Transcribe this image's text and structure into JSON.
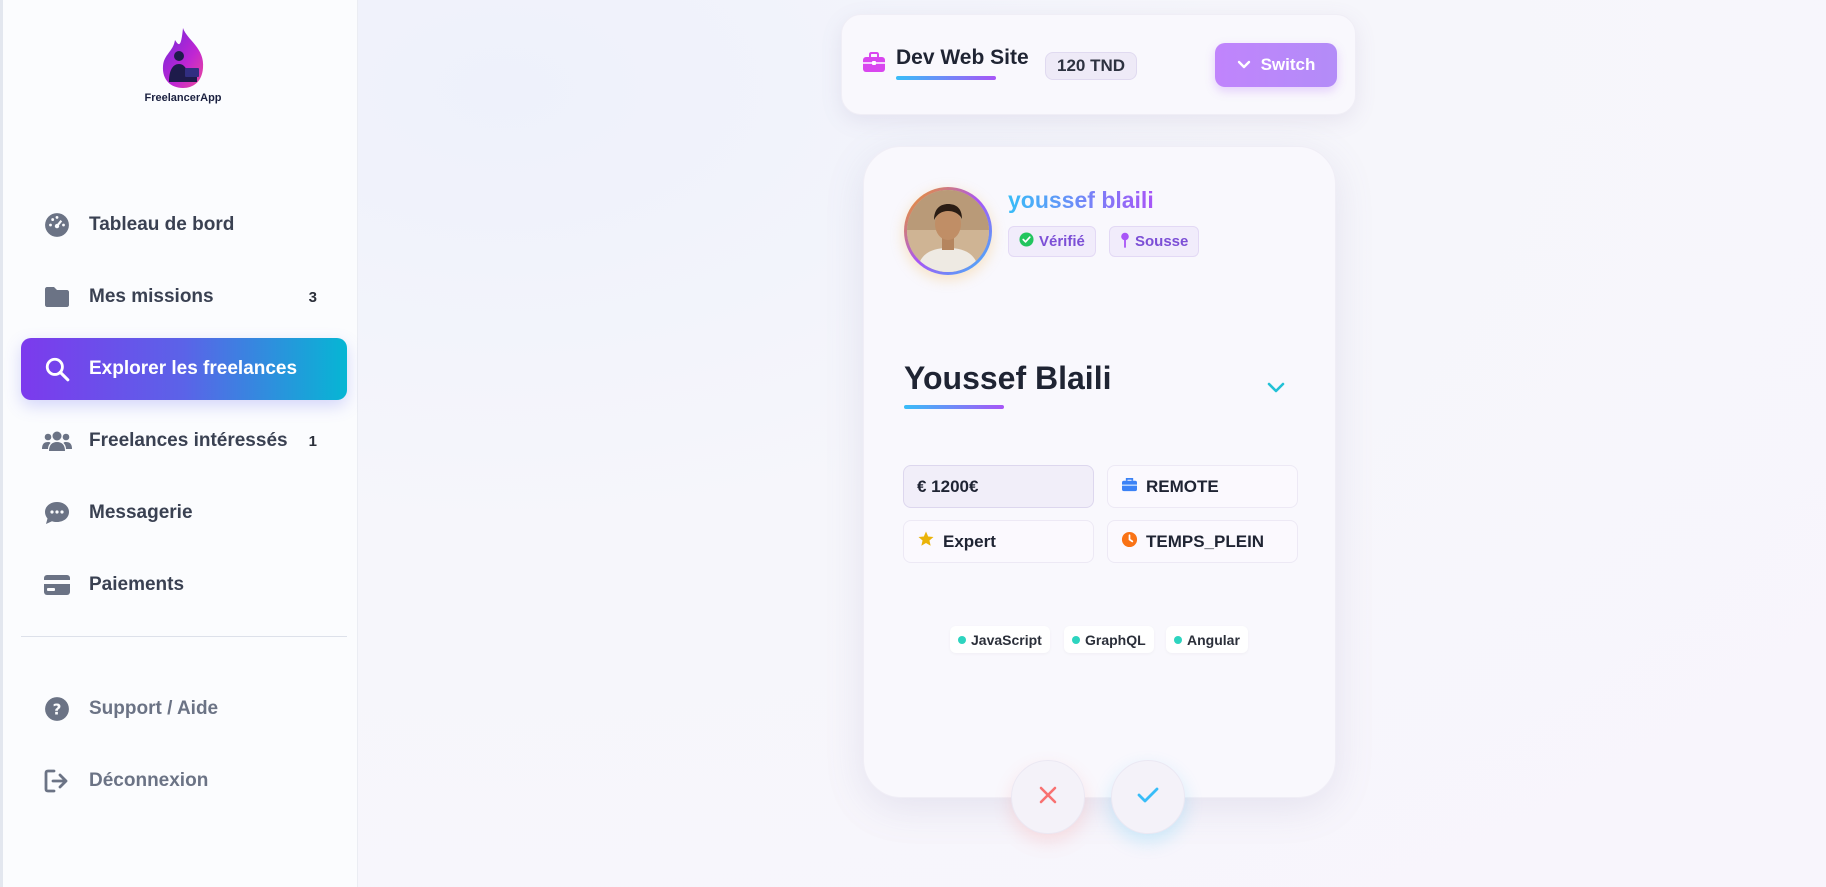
{
  "app": {
    "logo_text": "FreelancerApp"
  },
  "sidebar": {
    "items": [
      {
        "label": "Tableau de bord",
        "icon": "dashboard-icon",
        "count": ""
      },
      {
        "label": "Mes missions",
        "icon": "folder-icon",
        "count": "3"
      },
      {
        "label": "Explorer les freelances",
        "icon": "search-icon",
        "count": "",
        "active": true
      },
      {
        "label": "Freelances intéressés",
        "icon": "users-icon",
        "count": "1"
      },
      {
        "label": "Messagerie",
        "icon": "chat-icon",
        "count": ""
      },
      {
        "label": "Paiements",
        "icon": "credit-card-icon",
        "count": ""
      }
    ],
    "footer": [
      {
        "label": "Support / Aide",
        "icon": "help-icon"
      },
      {
        "label": "Déconnexion",
        "icon": "logout-icon"
      }
    ]
  },
  "topbar": {
    "mission_title": "Dev Web Site",
    "budget": "120 TND",
    "switch_label": "Switch"
  },
  "profile": {
    "username": "youssef blaili",
    "verified_label": "Vérifié",
    "location": "Sousse",
    "full_name": "Youssef Blaili",
    "stats": {
      "rate": "€ 1200€",
      "work_mode": "REMOTE",
      "level": "Expert",
      "contract": "TEMPS_PLEIN"
    },
    "skills": [
      "JavaScript",
      "GraphQL",
      "Angular"
    ]
  },
  "colors": {
    "accent_start": "#7c3aed",
    "accent_end": "#06b6d4",
    "reject": "#f87171",
    "accept": "#38bdf8"
  }
}
